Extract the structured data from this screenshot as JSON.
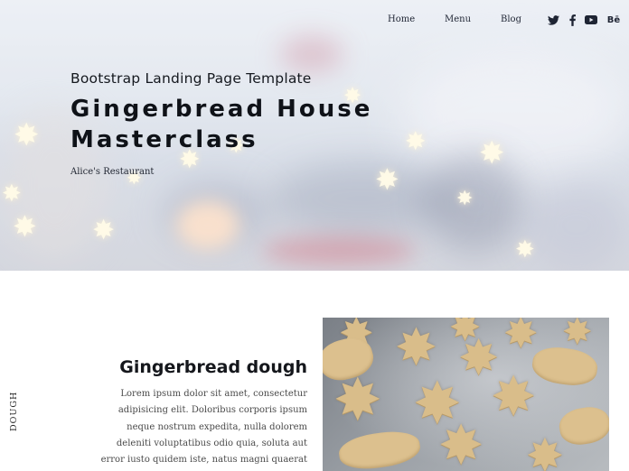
{
  "nav": {
    "links": [
      "Home",
      "Menu",
      "Blog"
    ],
    "social": [
      {
        "icon": "twitter-icon"
      },
      {
        "icon": "facebook-icon"
      },
      {
        "icon": "youtube-icon"
      },
      {
        "icon": "behance-icon",
        "glyph": "Bē"
      }
    ]
  },
  "hero": {
    "subtitle": "Bootstrap Landing Page Template",
    "title": "Gingerbread House Masterclass",
    "meta": "Alice's Restaurant"
  },
  "section": {
    "side_label": "DOUGH",
    "title": "Gingerbread dough",
    "body": "Lorem ipsum dolor sit amet, consectetur adipisicing elit. Doloribus corporis ipsum neque nostrum expedita, nulla dolorem deleniti voluptatibus odio quia, soluta aut error iusto quidem iste, natus magni quaerat odit."
  },
  "colors": {
    "text_dark": "#15171c",
    "body_text": "#4a4a4a",
    "cookie": "#d9bd8a"
  }
}
